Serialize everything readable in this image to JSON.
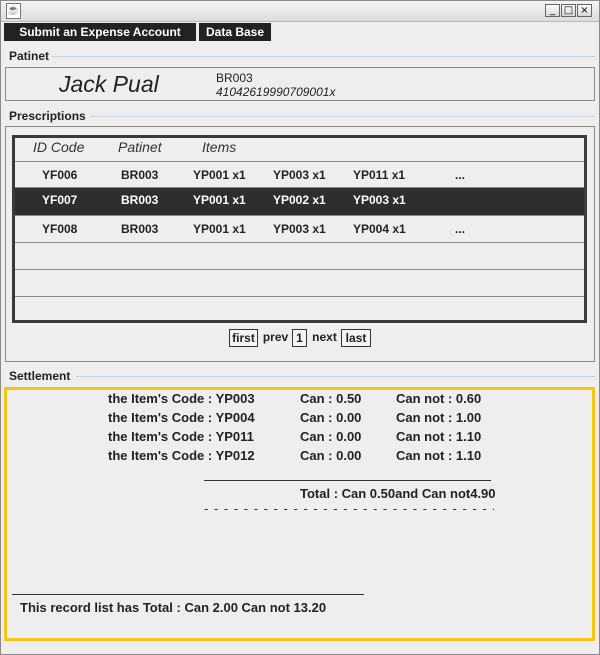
{
  "window": {
    "icon": "java-cup-icon",
    "controls": {
      "minimize": "_",
      "maximize": "□",
      "close": "×"
    }
  },
  "toolbar": {
    "submit_label": "Submit an Expense Account",
    "database_label": "Data Base"
  },
  "patient_section": {
    "title": "Patinet",
    "name": "Jack Pual",
    "patient_id": "BR003",
    "card_number": "41042619990709001x"
  },
  "prescriptions": {
    "title": "Prescriptions",
    "columns": [
      "ID Code",
      "Patinet",
      "Items"
    ],
    "rows": [
      {
        "id": "YF006",
        "patient": "BR003",
        "items": [
          "YP001 x1",
          "YP003 x1",
          "YP011 x1"
        ],
        "more": "...",
        "selected": false
      },
      {
        "id": "YF007",
        "patient": "BR003",
        "items": [
          "YP001 x1",
          "YP002 x1",
          "YP003 x1"
        ],
        "more": "",
        "selected": true
      },
      {
        "id": "YF008",
        "patient": "BR003",
        "items": [
          "YP001 x1",
          "YP003 x1",
          "YP004 x1"
        ],
        "more": "...",
        "selected": false
      }
    ],
    "pagination": {
      "first": "first",
      "prev": "prev",
      "page": "1",
      "next": "next",
      "last": "last"
    }
  },
  "settlement": {
    "title": "Settlement",
    "items": [
      {
        "code_label": "the Item's Code : YP003",
        "can": "Can : 0.50",
        "can_not": "Can not : 0.60"
      },
      {
        "code_label": "the Item's Code : YP004",
        "can": "Can : 0.00",
        "can_not": "Can not : 1.00"
      },
      {
        "code_label": "the Item's Code : YP011",
        "can": "Can : 0.00",
        "can_not": "Can not : 1.10"
      },
      {
        "code_label": "the Item's Code : YP012",
        "can": "Can : 0.00",
        "can_not": "Can not : 1.10"
      }
    ],
    "total": "Total : Can 0.50and Can not4.90",
    "dashes": "- - - - - - - - - - - - - - - - - - - - - - - - - - - - - - - - - - - -",
    "record_total": "This record list has Total : Can 2.00 Can not 13.20"
  },
  "colors": {
    "selected_row": "#2e2e2e",
    "settlement_border": "#f5c518",
    "toolbar_button": "#222222"
  }
}
